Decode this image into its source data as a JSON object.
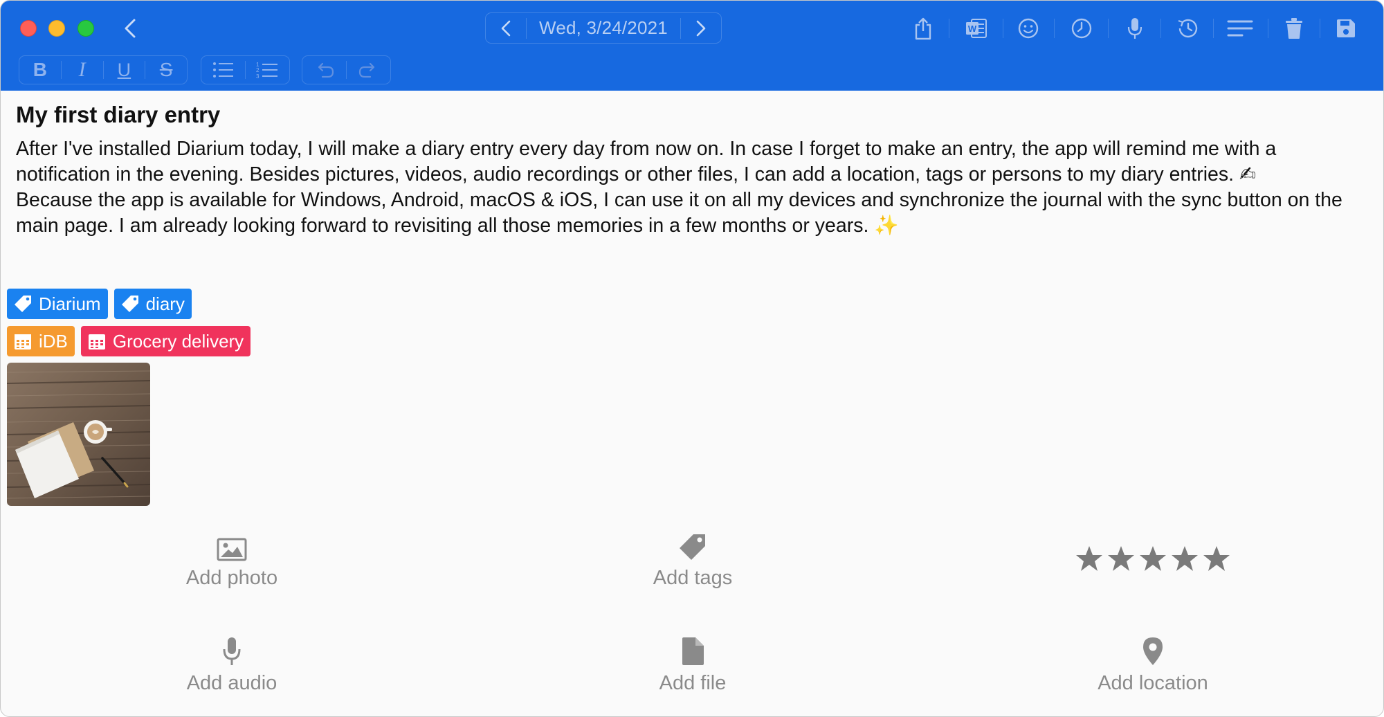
{
  "window": {
    "date": "Wed, 3/24/2021"
  },
  "toolbar": {
    "icons": [
      "share-icon",
      "word-export-icon",
      "emoji-icon",
      "clock-icon",
      "microphone-icon",
      "history-icon",
      "text-align-icon",
      "trash-icon",
      "save-icon"
    ],
    "format": {
      "bold": "B",
      "italic": "I",
      "underline": "U",
      "strike": "S"
    }
  },
  "entry": {
    "title": "My first diary entry",
    "paragraphs": [
      "After I've installed Diarium today, I will make a diary entry every day from now on. In case I forget to make an entry, the app will remind me with a notification in the evening. Besides pictures, videos, audio recordings or other files, I can add a location, tags or persons to my diary entries. ✍",
      "Because the app is available for Windows, Android, macOS & iOS, I can use it on all my devices and synchronize the journal with the sync button on the main page. I am already looking forward to revisiting all those memories in a few months or years. ✨"
    ]
  },
  "tags": [
    {
      "label": "Diarium",
      "color": "#1a82f0",
      "icon": "tag-icon"
    },
    {
      "label": "diary",
      "color": "#1a82f0",
      "icon": "tag-icon"
    }
  ],
  "events": [
    {
      "label": "iDB",
      "color": "#f59a2f",
      "icon": "calendar-icon"
    },
    {
      "label": "Grocery delivery",
      "color": "#f0335c",
      "icon": "calendar-icon"
    }
  ],
  "actions": {
    "add_photo": "Add photo",
    "add_tags": "Add tags",
    "add_audio": "Add audio",
    "add_file": "Add file",
    "add_location": "Add location"
  },
  "rating": {
    "stars": 5,
    "value": 0,
    "color": "#7a7a7a"
  },
  "colors": {
    "titlebar": "#1769e0",
    "tag_blue": "#1a82f0",
    "event_orange": "#f59a2f",
    "event_pink": "#f0335c",
    "action_gray": "#8a8a8a"
  }
}
